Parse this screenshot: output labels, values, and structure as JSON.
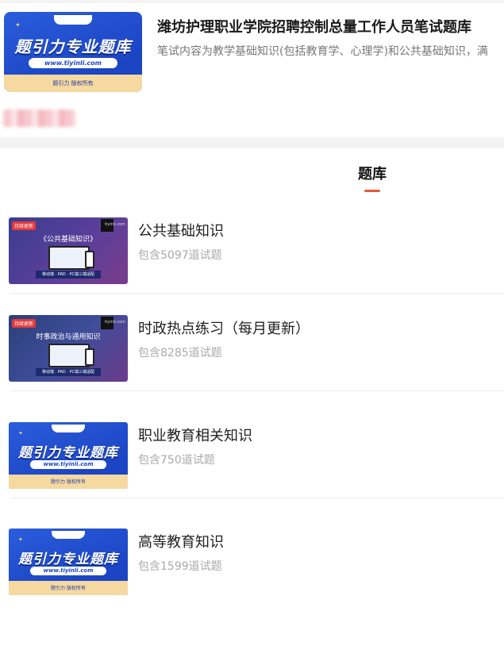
{
  "header": {
    "title": "潍坊护理职业学院招聘控制总量工作人员笔试题库",
    "description": "笔试内容为教学基础知识(包括教育学、心理学)和公共基础知识，满",
    "cover": {
      "big_text": "题引力专业题库",
      "url_text": "www.tiyinli.com",
      "note": "题引力 版权所有"
    }
  },
  "tab": {
    "label": "题库"
  },
  "items": [
    {
      "title": "公共基础知识",
      "count": "包含5097道试题",
      "cover": {
        "kind": "purple",
        "tag": "持续更新",
        "title": "《公共基础知识》",
        "bar": "移动端 · PAD · PC端三端适配",
        "site": "tiyinli.com"
      }
    },
    {
      "title": "时政热点练习（每月更新）",
      "count": "包含8285道试题",
      "cover": {
        "kind": "purple",
        "tag": "持续更新",
        "title": "时事政治与通用知识",
        "bar": "移动端 · PAD · PC端三端适配",
        "site": "tiyinli.com"
      }
    },
    {
      "title": "职业教育相关知识",
      "count": "包含750道试题",
      "cover": {
        "kind": "blue",
        "big_text": "题引力专业题库",
        "url_text": "www.tiyinli.com",
        "note": "题引力 版权所有"
      }
    },
    {
      "title": "高等教育知识",
      "count": "包含1599道试题",
      "cover": {
        "kind": "blue",
        "big_text": "题引力专业题库",
        "url_text": "www.tiyinli.com",
        "note": "题引力 版权所有"
      }
    }
  ],
  "colors": {
    "accent": "#e8553a",
    "brand_blue": "#1c45c4",
    "cover_gold": "#f6d9a0"
  }
}
